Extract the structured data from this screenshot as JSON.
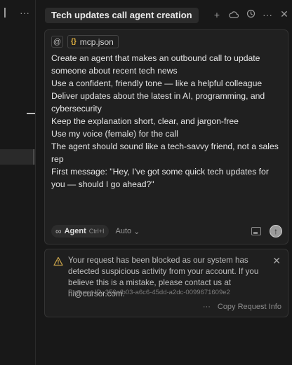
{
  "sidebar": {
    "more_label": "···"
  },
  "header": {
    "title": "Tech updates call agent creation",
    "icons": [
      "plus-icon",
      "cloud-icon",
      "history-icon",
      "more-icon",
      "close-icon"
    ],
    "plus": "+",
    "more": "···",
    "close": "✕"
  },
  "composer": {
    "at_symbol": "@",
    "file_chip": {
      "icon": "{}",
      "name": "mcp.json"
    },
    "prompt_lines": [
      "Create an agent that makes an outbound call to update someone about recent tech news",
      "Use a confident, friendly tone — like a helpful colleague",
      "Deliver updates about the latest in AI, programming, and cybersecurity",
      "Keep the explanation short, clear, and jargon-free",
      "Use my voice (female) for the call",
      "The agent should sound like a tech-savvy friend, not a sales rep",
      "First message: \"Hey, I've got some quick tech updates for you — should I go ahead?\""
    ],
    "mode": {
      "icon": "∞",
      "label": "Agent",
      "shortcut": "Ctrl+I"
    },
    "model": {
      "label": "Auto",
      "chevron": "⌄"
    },
    "send_icon": "↑"
  },
  "alert": {
    "message": "Your request has been blocked as our system has detected suspicious activity from your account. If you believe this is a mistake, please contact us at hi@cursor.com.",
    "request_id": "Request ID: 356efb03-a6c6-45dd-a2dc-0099671609e2",
    "more": "···",
    "copy_label": "Copy Request Info",
    "close": "✕",
    "accent_color": "#c8a24a"
  }
}
